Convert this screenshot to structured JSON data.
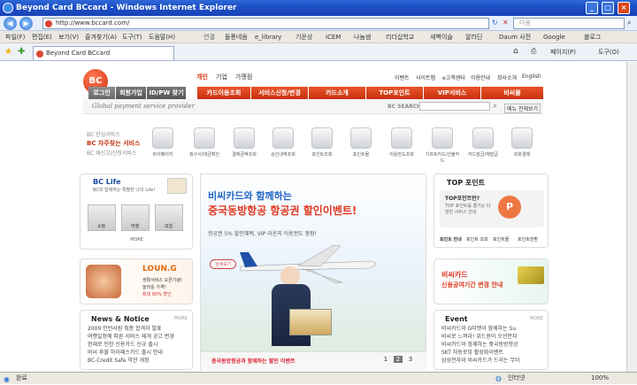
{
  "window": {
    "title": "Beyond Card BCcard - Windows Internet Explorer"
  },
  "address": {
    "url": "http://www.bccard.com/",
    "search_placeholder": "다음"
  },
  "menu": {
    "items": [
      "파일(F)",
      "편집(E)",
      "보기(V)",
      "즐겨찾기(A)",
      "도구(T)",
      "도움말(H)"
    ],
    "links_label": "연결",
    "links": [
      "돌풍네음",
      "e_library",
      "기운상",
      "iCEM",
      "나눔샘",
      "리더십학교",
      "새벽이슬",
      "알라딘",
      "Daum 사전",
      "Google",
      "블로그"
    ]
  },
  "tab": {
    "label": "Beyond Card BCcard",
    "page_btn": "페이지(P)",
    "tools_btn": "도구(O)"
  },
  "site": {
    "top_links": [
      "개인",
      "기업",
      "가맹점"
    ],
    "util_links": [
      "이벤트",
      "사이트맵",
      "e고객센터",
      "이용안내",
      "회사소개",
      "English"
    ],
    "login_tabs": [
      "로그인",
      "회원가입",
      "ID/PW 찾기"
    ],
    "main_nav": [
      "카드이용조회",
      "서비스신청/변경",
      "카드소개",
      "TOP포인트",
      "VIP서비스",
      "비씨몰"
    ],
    "slogan": "Global payment service provider",
    "search_label": "BC SEARCH",
    "menu_all": "메뉴 전체보기",
    "side_services": [
      "BC 안심서비스",
      "BC 자주찾는 서비스",
      "BC 재신고/신청서비스"
    ],
    "services": [
      "마이페이지",
      "청구서/대금확인",
      "결제금액조회",
      "승인내역조회",
      "포인트조회",
      "포인트몰",
      "이용한도조회",
      "기프트카드/선불카드",
      "카드발급/재발급",
      "외화결제"
    ],
    "bclife": {
      "title": "BC Life",
      "sub": "BC와 함께하는 특별한 나의 Life!",
      "items": [
        "쇼핑",
        "여행",
        "보험"
      ],
      "more": "MORE"
    },
    "banner": {
      "line1": "비씨카드와 함께하는",
      "line2": "중국동방항공 항공권 할인이벤트!",
      "desc": "항공권 5% 할인혜택, VIP 라운지 이용권도 팡팡!",
      "detail_btn": "상세보기",
      "caption": "중국동방항공과 함께하는 할인 이벤트",
      "pages": [
        "1",
        "2",
        "3"
      ]
    },
    "loung": {
      "title": "LOUN.G",
      "text": [
        "생활서비스 오픈기념!",
        "놀라운 가격!",
        "최대 90% 할인"
      ]
    },
    "top_point": {
      "title": "TOP 포인트",
      "q": "TOP포인트란?",
      "desc": "TOP 포인트를 즐기는 다양한 서비스 안내",
      "links": [
        "포인트 안내",
        "포인트 조회",
        "포인트몰",
        "포인트전환"
      ]
    },
    "extend": {
      "line1": "비씨카드",
      "line2": "신용공여기간 변경 안내"
    },
    "news": {
      "title": "News & Notice",
      "more": "MORE",
      "items": [
        "2009 인턴사원 최종 합격자 발표",
        "여행일정에 따른 서비스 재개 공고 변경",
        "현재로 인한 신용카드 신규 출시",
        "비씨 후불 하이패스카드 출시 안내",
        "BC-Credit Safe 약관 개정"
      ]
    },
    "event": {
      "title": "Event",
      "more": "MORE",
      "items": [
        "비씨카드와 G마켓이 함께하는 Su",
        "비씨로 느껴라! 위드윈이 오션분쟈",
        "비씨카드와 함께하는 중국동방항공",
        "SKT 자동로밍 활성화이벤트",
        "삼성전자와 비씨카드가 드리는 무이"
      ]
    }
  },
  "status": {
    "left": "완료",
    "zone": "인터넷",
    "zoom": "100%"
  }
}
